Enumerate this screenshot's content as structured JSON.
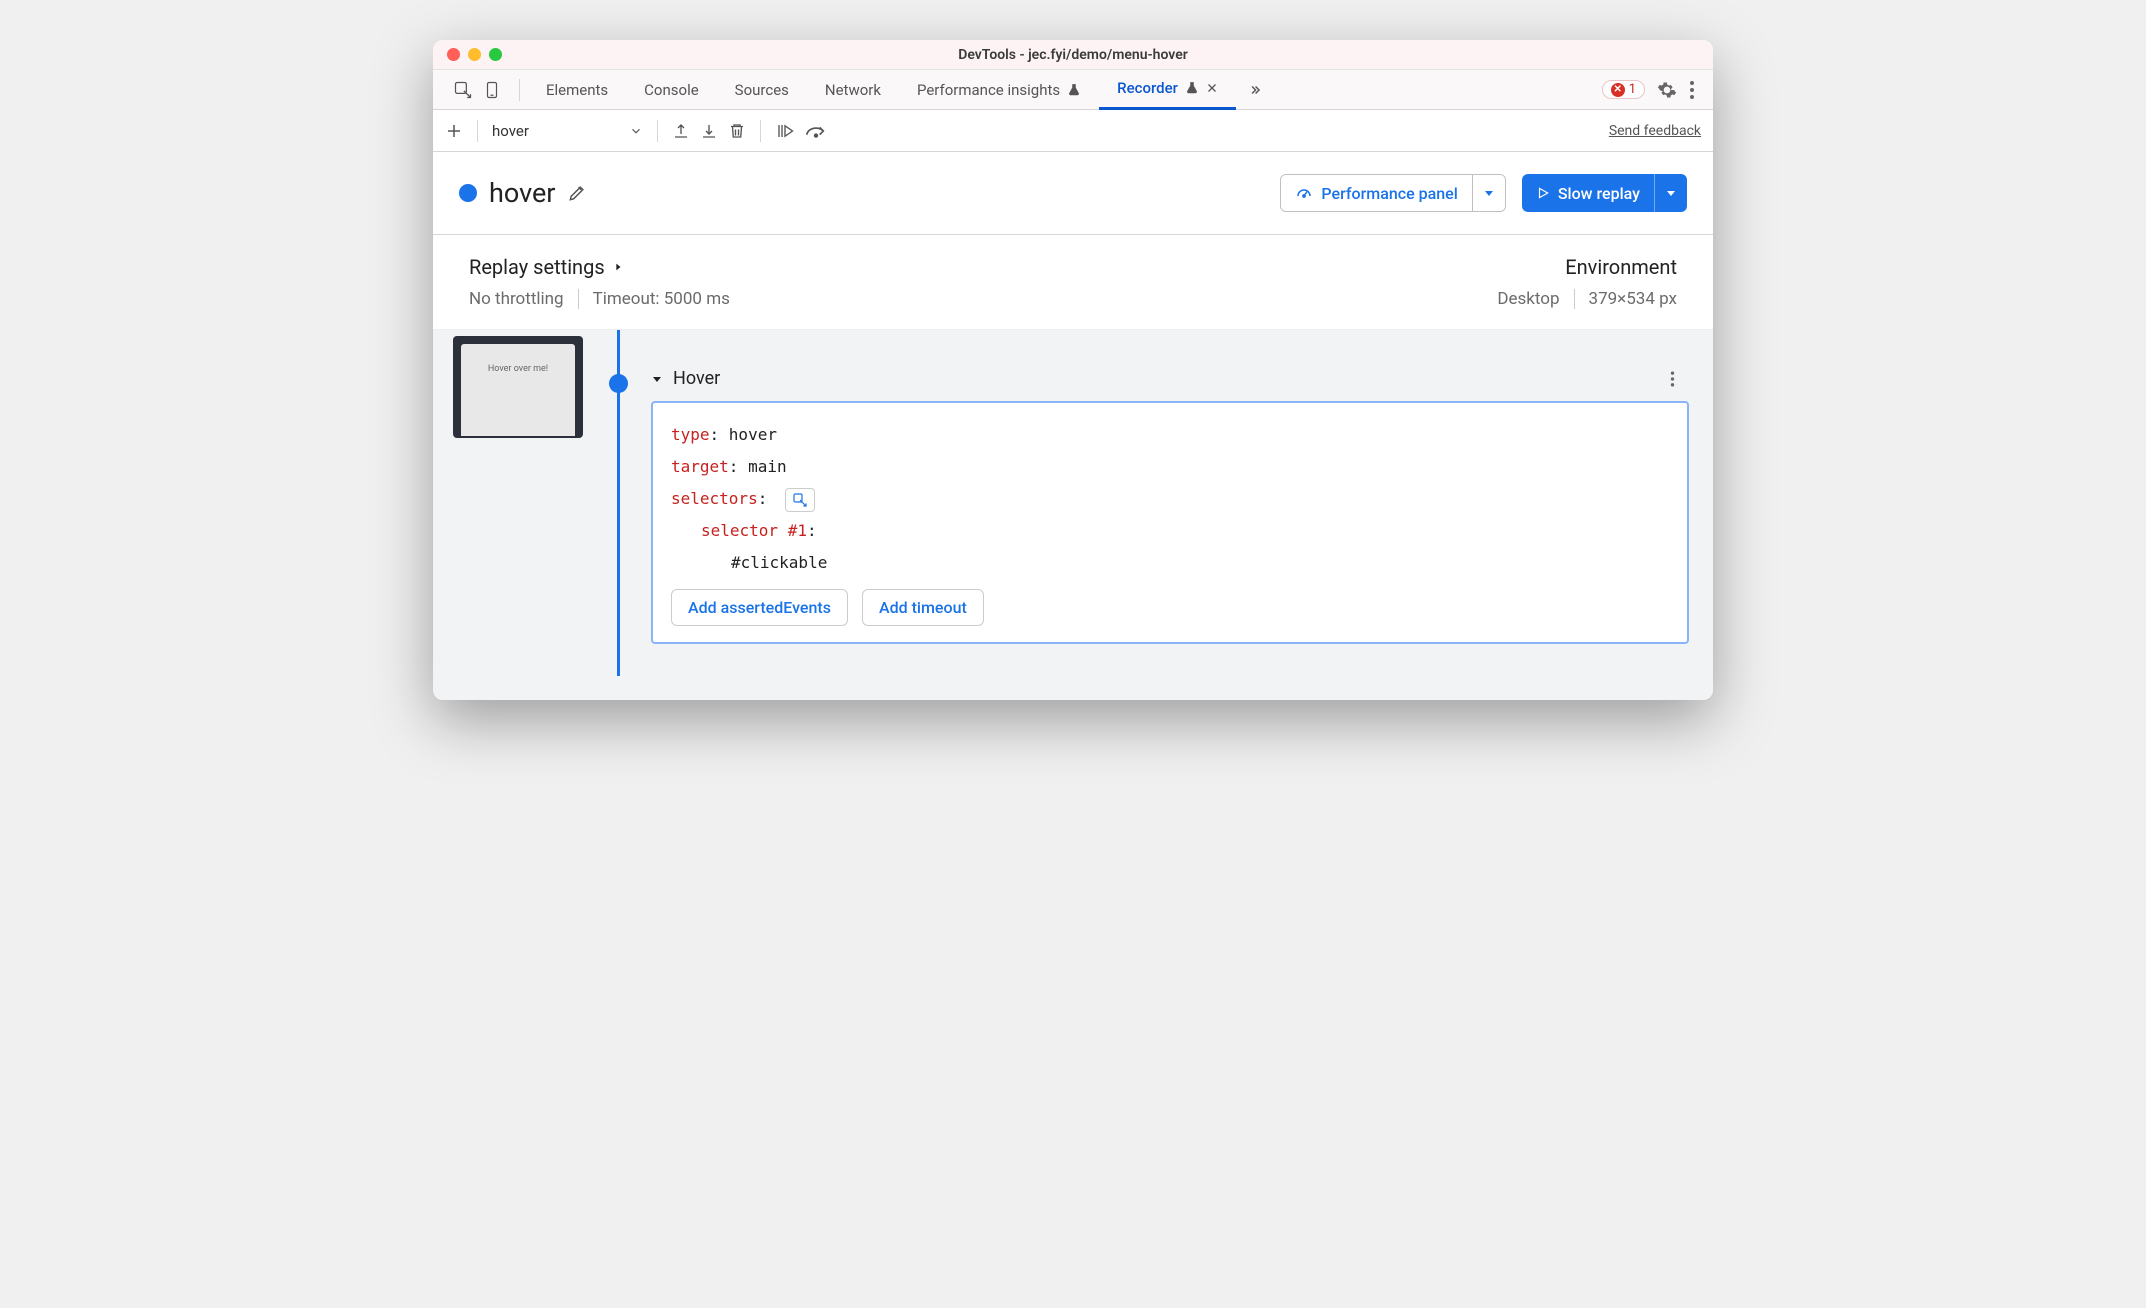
{
  "window": {
    "title": "DevTools - jec.fyi/demo/menu-hover"
  },
  "tabs": {
    "items": [
      "Elements",
      "Console",
      "Sources",
      "Network",
      "Performance insights",
      "Recorder"
    ],
    "active": "Recorder",
    "error_count": "1"
  },
  "toolbar": {
    "dropdown_value": "hover",
    "feedback": "Send feedback"
  },
  "recording": {
    "title": "hover",
    "perf_button": "Performance panel",
    "replay_button": "Slow replay"
  },
  "settings": {
    "replay_heading": "Replay settings",
    "throttling": "No throttling",
    "timeout": "Timeout: 5000 ms",
    "env_heading": "Environment",
    "device": "Desktop",
    "viewport": "379×534 px"
  },
  "thumbnail": {
    "caption": "Hover over me!"
  },
  "step": {
    "title": "Hover",
    "type_key": "type",
    "type_val": "hover",
    "target_key": "target",
    "target_val": "main",
    "selectors_key": "selectors",
    "selector1_key": "selector #1",
    "selector1_val": "#clickable",
    "add_asserted": "Add assertedEvents",
    "add_timeout": "Add timeout"
  }
}
